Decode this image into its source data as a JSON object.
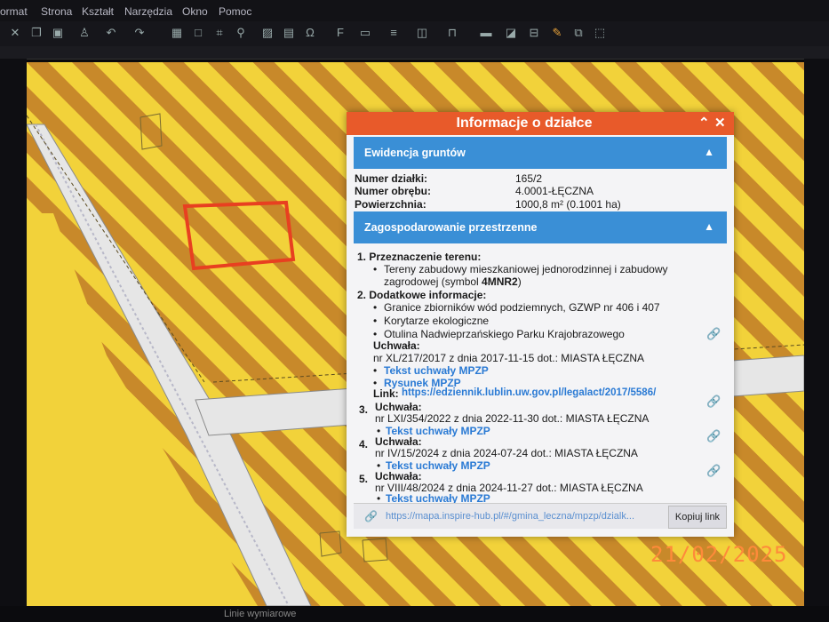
{
  "menu": [
    "ormat",
    "Strona",
    "Kształt",
    "Narzędzia",
    "Okno",
    "Pomoc"
  ],
  "toolbar_icons": [
    "cut-icon",
    "copy-icon",
    "paste-icon",
    "clone-icon",
    "undo-icon",
    "redo-icon",
    "grid-icon",
    "crop-icon",
    "zoom-icon",
    "image-icon",
    "chart-icon",
    "omega-icon",
    "fontwork-icon",
    "textbox-icon",
    "align-icon",
    "arrange-icon",
    "distribute-icon",
    "shadow-icon",
    "crop-2-icon",
    "glue-icon",
    "group-icon"
  ],
  "panel": {
    "title": "Informacje o działce",
    "section1": "Ewidencja gruntów",
    "fields": [
      {
        "label": "Numer działki:",
        "value": "165/2"
      },
      {
        "label": "Numer obrębu:",
        "value": "4.0001-ŁĘCZNA"
      },
      {
        "label": "Powierzchnia:",
        "value": "1000,8 m² (0.1001 ha)"
      }
    ],
    "section2": "Zagospodarowanie przestrzenne",
    "item1_title": "1.  Przeznaczenie terenu:",
    "item1_line1": "Tereny zabudowy mieszkaniowej jednorodzinnej i zabudowy",
    "item1_line2a": "zagrodowej (symbol ",
    "item1_line2b": "4MNR2",
    "item1_line2c": ")",
    "item2_title": "2.  Dodatkowe informacje:",
    "item2_b1": "Granice zbiorników wód podziemnych, GZWP nr 406 i 407",
    "item2_b2": "Korytarze ekologiczne",
    "item2_b3": "Otulina Nadwieprzańskiego Parku Krajobrazowego",
    "uchwala": "Uchwała:",
    "u1_text": "nr XL/217/2017 z dnia 2017-11-15 dot.: MIASTA ŁĘCZNA",
    "u1_link1": "Tekst uchwały MPZP",
    "u1_link2": "Rysunek MPZP",
    "link_label": "Link:",
    "link_url": "https://edziennik.lublin.uw.gov.pl/legalact/2017/5586/",
    "u3_num": "3.",
    "u3_text": "nr LXI/354/2022 z dnia 2022-11-30 dot.: MIASTA ŁĘCZNA",
    "u4_num": "4.",
    "u4_text": "nr IV/15/2024 z dnia 2024-07-24 dot.: MIASTA ŁĘCZNA",
    "u5_num": "5.",
    "u5_text": "nr VIII/48/2024 z dnia 2024-11-27 dot.: MIASTA ŁĘCZNA",
    "tekst_link": "Tekst uchwały MPZP",
    "bottom_url": "https://mapa.inspire-hub.pl/#/gmina_leczna/mpzp/dzialk...",
    "copy_button": "Kopiuj link"
  },
  "status": {
    "left": "Linie wymiarowe"
  },
  "date_stamp": "21/02/2025",
  "colors": {
    "accent": "#e85a2a",
    "section": "#3a8fd6",
    "map_yellow": "#f2d23a",
    "map_stripe": "#c8892a",
    "parcel": "#e84020"
  }
}
